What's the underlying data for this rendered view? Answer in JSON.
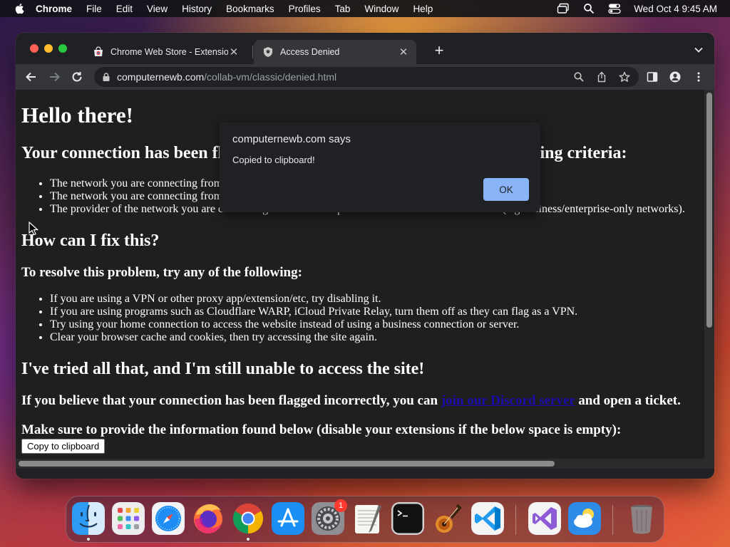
{
  "menubar": {
    "app_name": "Chrome",
    "items": [
      "File",
      "Edit",
      "View",
      "History",
      "Bookmarks",
      "Profiles",
      "Tab",
      "Window",
      "Help"
    ],
    "clock": "Wed Oct 4  9:45 AM"
  },
  "tabs": [
    {
      "title": "Chrome Web Store - Extensions",
      "active": false
    },
    {
      "title": "Access Denied",
      "active": true
    }
  ],
  "omnibox": {
    "host": "computernewb.com",
    "path": "/collab-vm/classic/denied.html"
  },
  "page": {
    "h1": "Hello there!",
    "connection_heading": "Your connection has been flagged for meeting one or more of the following criteria:",
    "criteria": [
      "The network you are connecting from belongs to a hosting/datacenter/colocation provider.",
      "The network you are connecting from has been confirmed to belong to a VPN or proxy service.",
      "The provider of the network you are connecting from does not provide residential internet services (e.g business/enterprise-only networks)."
    ],
    "fix_heading": "How can I fix this?",
    "resolve_heading": "To resolve this problem, try any of the following:",
    "fixes": [
      "If you are using a VPN or other proxy app/extension/etc, try disabling it.",
      "If you are using programs such as Cloudflare WARP, iCloud Private Relay, turn them off as they can flag as a VPN.",
      "Try using your home connection to access the website instead of using a business connection or server.",
      "Clear your browser cache and cookies, then try accessing the site again."
    ],
    "tried_heading": "I've tried all that, and I'm still unable to access the site!",
    "believe_before": "If you believe that your connection has been flagged incorrectly, you can ",
    "discord_link": "join our Discord server",
    "believe_after": " and open a ticket.",
    "make_sure": "Make sure to provide the information found below (disable your extensions if the below space is empty):",
    "copy_button": "Copy to clipboard"
  },
  "dialog": {
    "title": "computernewb.com says",
    "message": "Copied to clipboard!",
    "ok_label": "OK"
  },
  "dock": {
    "apps": [
      "finder",
      "launchpad",
      "safari",
      "firefox",
      "chrome",
      "app-store",
      "system-settings",
      "textedit",
      "terminal",
      "garageband",
      "vscode",
      "visual-studio",
      "weather",
      "trash"
    ],
    "system_settings_badge": "1"
  },
  "colors": {
    "dialog_ok": "#8ab4f8",
    "link": "#1a0dab",
    "page_bg": "#1f1f1f"
  }
}
